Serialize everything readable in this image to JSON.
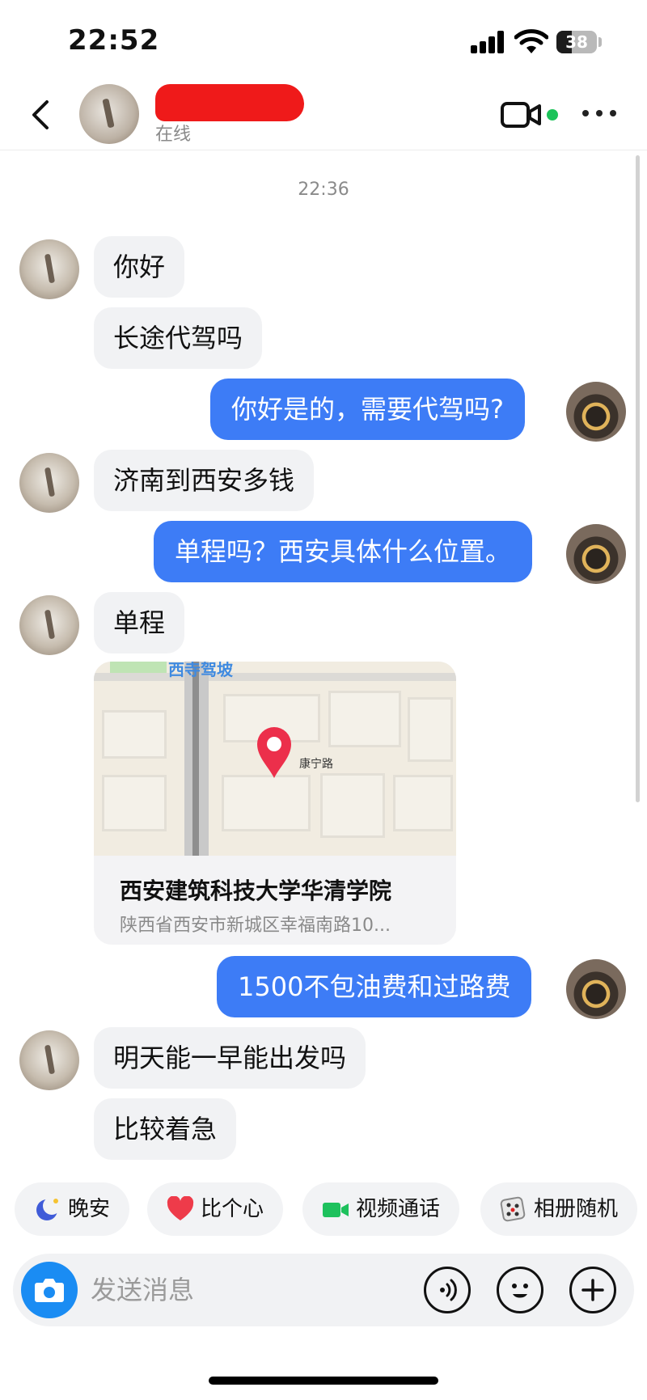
{
  "status_bar": {
    "time": "22:52",
    "battery": "38",
    "battery_level": 0.38
  },
  "header": {
    "contact_name": "",
    "contact_status": "在线"
  },
  "chat": {
    "timestamp": "22:36",
    "messages": [
      {
        "side": "in",
        "text": "你好"
      },
      {
        "side": "in",
        "text": "长途代驾吗"
      },
      {
        "side": "out",
        "text": "你好是的，需要代驾吗?"
      },
      {
        "side": "in",
        "text": "济南到西安多钱"
      },
      {
        "side": "out",
        "text": "单程吗？西安具体什么位置。"
      },
      {
        "side": "in",
        "text": "单程"
      },
      {
        "side": "out",
        "text": "1500不包油费和过路费"
      },
      {
        "side": "in",
        "text": "明天能一早能出发吗"
      },
      {
        "side": "in",
        "text": "比较着急"
      }
    ],
    "location": {
      "title": "西安建筑科技大学华清学院",
      "address": "陕西省西安市新城区幸福南路10...",
      "map_road_label": "西寺驾坡",
      "map_street_label": "康宁路"
    }
  },
  "quick_replies": [
    {
      "label": "晚安",
      "icon": "moon-icon"
    },
    {
      "label": "比个心",
      "icon": "heart-icon"
    },
    {
      "label": "视频通话",
      "icon": "video-camera-icon"
    },
    {
      "label": "相册随机",
      "icon": "dice-icon"
    }
  ],
  "input": {
    "placeholder": "发送消息"
  },
  "colors": {
    "outgoing_bubble": "#3d7cf6",
    "incoming_bubble": "#f1f2f4",
    "online": "#1dc35a",
    "camera_button": "#1a8cf3",
    "redaction": "#ef1a1a"
  }
}
